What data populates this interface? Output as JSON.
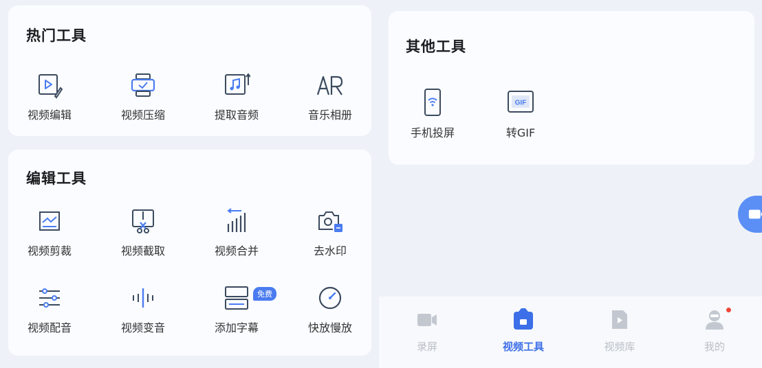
{
  "hot_tools": {
    "title": "热门工具",
    "items": [
      {
        "label": "视频编辑",
        "icon": "video-edit-icon"
      },
      {
        "label": "视频压缩",
        "icon": "video-compress-icon"
      },
      {
        "label": "提取音频",
        "icon": "extract-audio-icon"
      },
      {
        "label": "音乐相册",
        "icon": "music-album-icon"
      }
    ]
  },
  "edit_tools": {
    "title": "编辑工具",
    "items": [
      {
        "label": "视频剪裁",
        "icon": "crop-icon"
      },
      {
        "label": "视频截取",
        "icon": "video-cut-icon"
      },
      {
        "label": "视频合并",
        "icon": "video-merge-icon"
      },
      {
        "label": "去水印",
        "icon": "remove-watermark-icon"
      },
      {
        "label": "视频配音",
        "icon": "dubbing-icon"
      },
      {
        "label": "视频变音",
        "icon": "voice-change-icon"
      },
      {
        "label": "添加字幕",
        "icon": "subtitle-icon",
        "badge": "免费"
      },
      {
        "label": "快放慢放",
        "icon": "speed-icon"
      }
    ]
  },
  "other_tools": {
    "title": "其他工具",
    "items": [
      {
        "label": "手机投屏",
        "icon": "screen-cast-icon"
      },
      {
        "label": "转GIF",
        "icon": "gif-icon",
        "icon_text": "GIF"
      }
    ]
  },
  "tabs": [
    {
      "label": "录屏",
      "icon": "record-icon",
      "active": false
    },
    {
      "label": "视频工具",
      "icon": "video-tools-icon",
      "active": true
    },
    {
      "label": "视频库",
      "icon": "video-library-icon",
      "active": false
    },
    {
      "label": "我的",
      "icon": "profile-icon",
      "active": false,
      "dot": true
    }
  ],
  "colors": {
    "accent": "#3d6fe8",
    "icon": "#3b4a5e",
    "icon_accent": "#4a7cf0",
    "inactive": "#c3c8d0",
    "dot": "#f0453a"
  }
}
